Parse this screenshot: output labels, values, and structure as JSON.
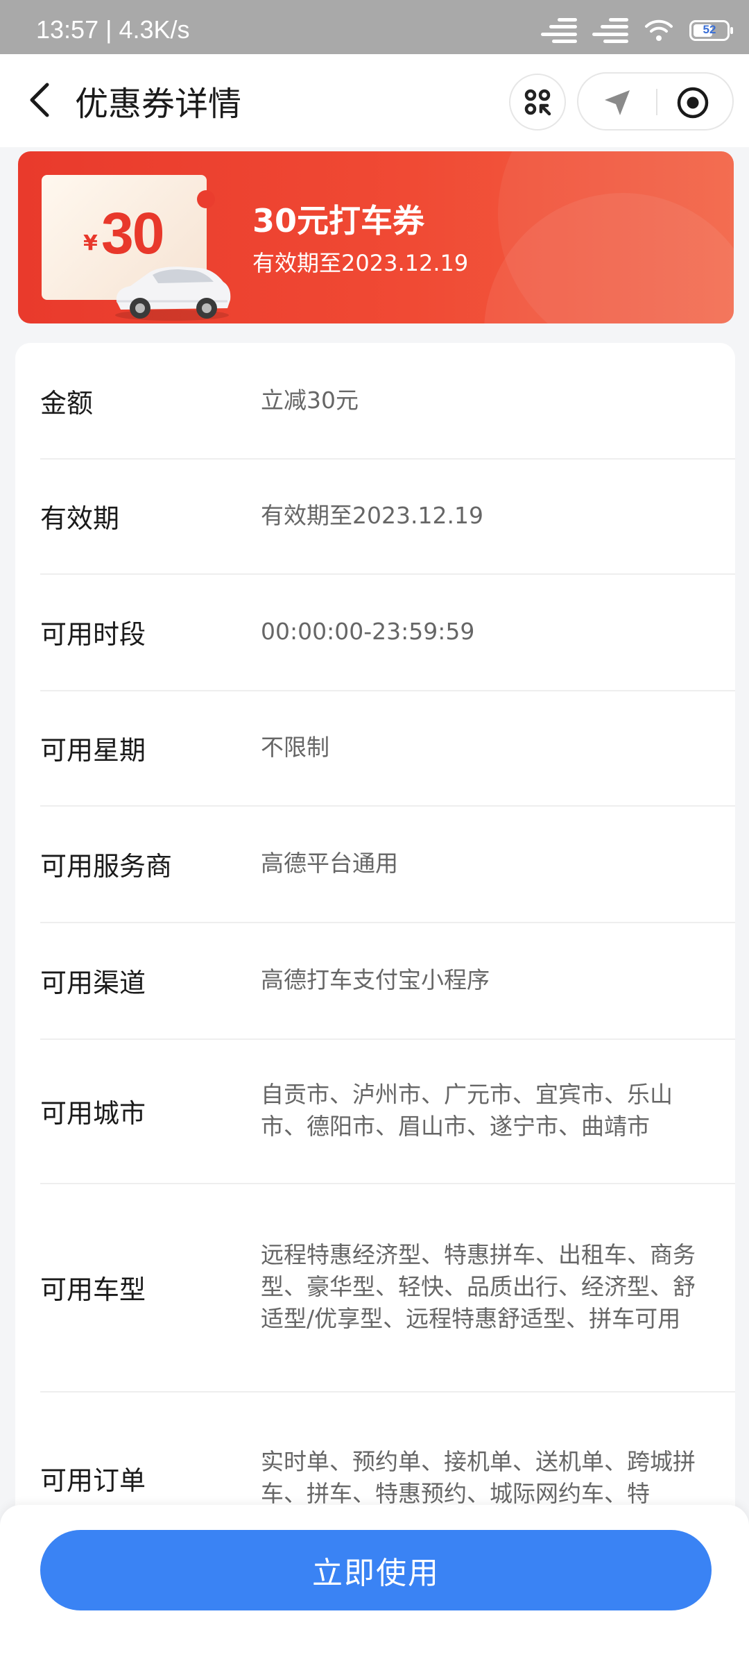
{
  "status_bar": {
    "time": "13:57 | 4.3K/s",
    "battery": "52"
  },
  "nav": {
    "title": "优惠券详情"
  },
  "coupon": {
    "currency_symbol": "¥",
    "amount": "30",
    "title": "30元打车券",
    "validity": "有效期至2023.12.19",
    "accent_color": "#e93a2c"
  },
  "details": [
    {
      "label": "金额",
      "value": "立减30元"
    },
    {
      "label": "有效期",
      "value": "有效期至2023.12.19"
    },
    {
      "label": "可用时段",
      "value": "00:00:00-23:59:59"
    },
    {
      "label": "可用星期",
      "value": "不限制"
    },
    {
      "label": "可用服务商",
      "value": "高德平台通用"
    },
    {
      "label": "可用渠道",
      "value": "高德打车支付宝小程序"
    },
    {
      "label": "可用城市",
      "value": "自贡市、泸州市、广元市、宜宾市、乐山市、德阳市、眉山市、遂宁市、曲靖市"
    },
    {
      "label": "可用车型",
      "value": "远程特惠经济型、特惠拼车、出租车、商务型、豪华型、轻快、品质出行、经济型、舒适型/优享型、远程特惠舒适型、拼车可用"
    },
    {
      "label": "可用订单",
      "value": "实时单、预约单、接机单、送机单、跨城拼车、拼车、特惠预约、城际网约车、特"
    }
  ],
  "action": {
    "use_button": "立即使用",
    "button_color": "#3a83f4"
  }
}
